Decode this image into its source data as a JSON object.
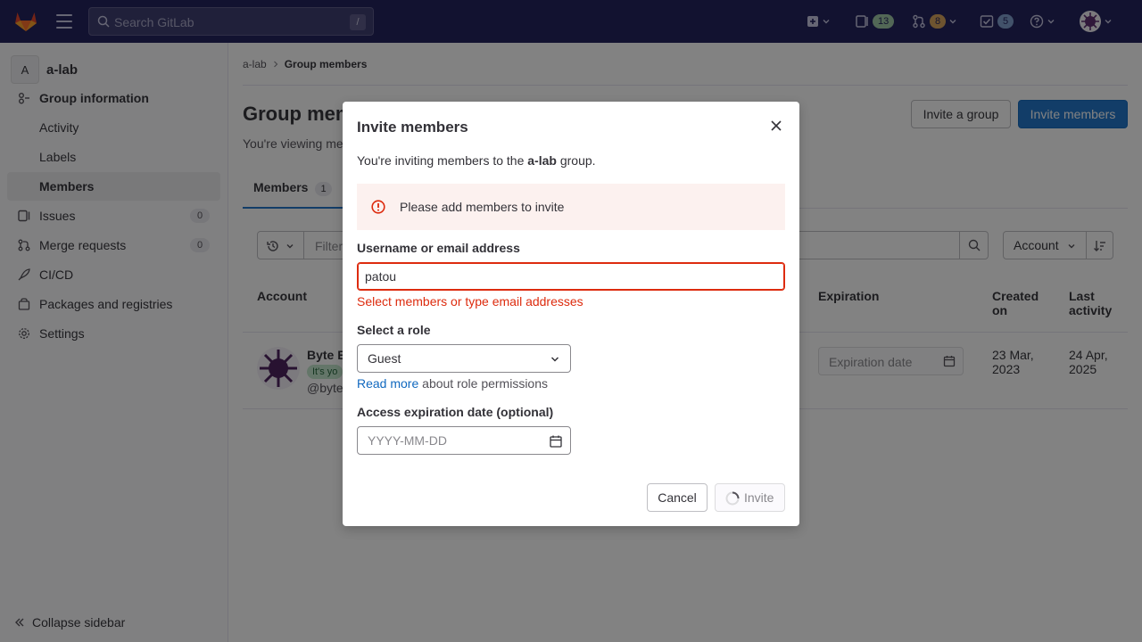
{
  "topbar": {
    "search_placeholder": "Search GitLab",
    "search_shortcut": "/",
    "issues_count": "13",
    "merge_requests_count": "8",
    "todos_count": "5"
  },
  "sidebar": {
    "group_avatar_letter": "A",
    "group_name": "a-lab",
    "items": [
      {
        "label": "Group information"
      },
      {
        "label": "Activity"
      },
      {
        "label": "Labels"
      },
      {
        "label": "Members"
      },
      {
        "label": "Issues",
        "count": "0"
      },
      {
        "label": "Merge requests",
        "count": "0"
      },
      {
        "label": "CI/CD"
      },
      {
        "label": "Packages and registries"
      },
      {
        "label": "Settings"
      }
    ],
    "collapse_label": "Collapse sidebar"
  },
  "breadcrumb": {
    "root": "a-lab",
    "current": "Group members"
  },
  "page": {
    "title": "Group mem",
    "subtitle": "You're viewing me",
    "invite_group_label": "Invite a group",
    "invite_members_label": "Invite members",
    "tab_label": "Members",
    "tab_count": "1",
    "filter_placeholder": "Filter",
    "sort_label": "Account"
  },
  "table": {
    "headers": {
      "account": "Account",
      "expiration": "Expiration",
      "created_on": "Created on",
      "last_activity": "Last activity"
    },
    "row": {
      "name": "Byte B",
      "badge": "It's yo",
      "username": "@byte",
      "expiration_placeholder": "Expiration date",
      "created_on": "23 Mar, 2023",
      "last_activity": "24 Apr, 2025"
    }
  },
  "modal": {
    "title": "Invite members",
    "intro_prefix": "You're inviting members to the ",
    "intro_group": "a-lab",
    "intro_suffix": " group.",
    "alert_text": "Please add members to invite",
    "username_label": "Username or email address",
    "username_value": "patou",
    "username_error": "Select members or type email addresses",
    "role_label": "Select a role",
    "role_value": "Guest",
    "read_more_link": "Read more",
    "read_more_suffix": " about role permissions",
    "date_label": "Access expiration date (optional)",
    "date_placeholder": "YYYY-MM-DD",
    "cancel_label": "Cancel",
    "invite_label": "Invite"
  },
  "colors": {
    "topbar_bg": "#1f1e5a",
    "primary": "#1f75cb",
    "danger": "#dd2b0e",
    "alert_bg": "#fcf1ef"
  }
}
